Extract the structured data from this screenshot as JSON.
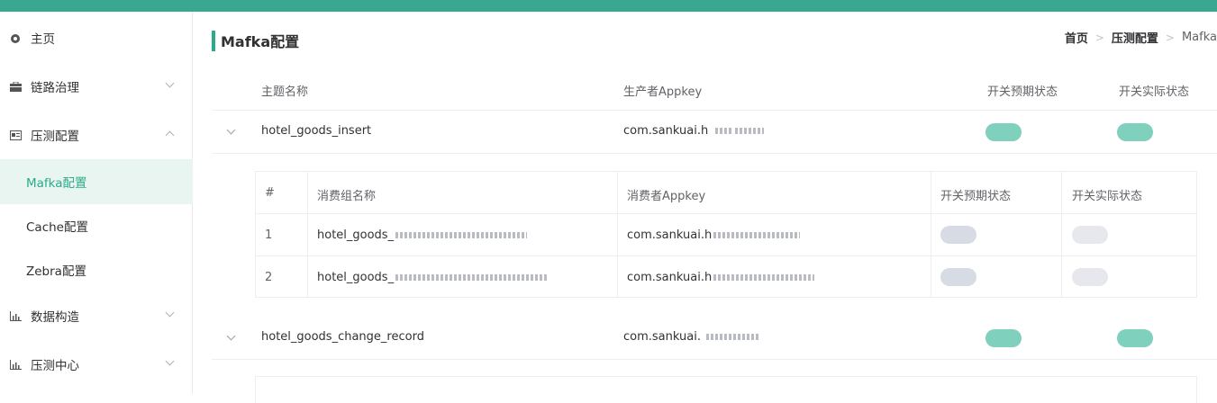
{
  "sidebar": {
    "items": [
      {
        "label": "主页",
        "icon": "dashboard-icon"
      },
      {
        "label": "链路治理",
        "icon": "briefcase-icon"
      },
      {
        "label": "压测配置",
        "icon": "card-icon"
      },
      {
        "label": "Mafka配置"
      },
      {
        "label": "Cache配置"
      },
      {
        "label": "Zebra配置"
      },
      {
        "label": "数据构造",
        "icon": "bar-chart-icon"
      },
      {
        "label": "压测中心",
        "icon": "bar-chart-icon"
      }
    ]
  },
  "page": {
    "title": "Mafka配置",
    "breadcrumb": [
      "首页",
      "压测配置",
      "Mafka"
    ]
  },
  "table": {
    "headers": [
      "主题名称",
      "生产者Appkey",
      "开关预期状态",
      "开关实际状态"
    ],
    "rows": [
      {
        "topic": "hotel_goods_insert",
        "appkey": "com.sankuai.h",
        "expected": "on",
        "actual": "on"
      },
      {
        "topic": "hotel_goods_change_record",
        "appkey": "com.sankuai.",
        "expected": "on",
        "actual": "on"
      }
    ]
  },
  "subtable": {
    "headers": [
      "#",
      "消费组名称",
      "消费者Appkey",
      "开关预期状态",
      "开关实际状态"
    ],
    "rows": [
      {
        "index": "1",
        "group": "hotel_goods_",
        "appkey": "com.sankuai.h",
        "expected": "off",
        "actual": "off"
      },
      {
        "index": "2",
        "group": "hotel_goods_",
        "appkey": "com.sankuai.h",
        "expected": "off",
        "actual": "off"
      }
    ]
  },
  "colors": {
    "accent": "#2bab89",
    "switch_on": "#7fd0bc",
    "topbar": "#3aa890"
  }
}
